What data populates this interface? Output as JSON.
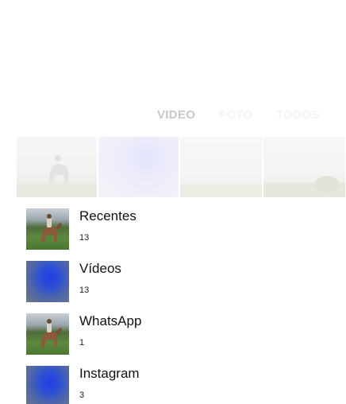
{
  "tabs": [
    {
      "label": "VIDEO",
      "active": true
    },
    {
      "label": "FOTO",
      "active": false
    },
    {
      "label": "TODOS",
      "active": false
    }
  ],
  "albums": [
    {
      "name": "Recentes",
      "count": "13",
      "thumb_icon": "horse-rider-photo"
    },
    {
      "name": "Vídeos",
      "count": "13",
      "thumb_icon": "blue-blur-photo"
    },
    {
      "name": "WhatsApp",
      "count": "1",
      "thumb_icon": "horse-rider-photo"
    },
    {
      "name": "Instagram",
      "count": "3",
      "thumb_icon": "blue-blur-photo"
    }
  ]
}
